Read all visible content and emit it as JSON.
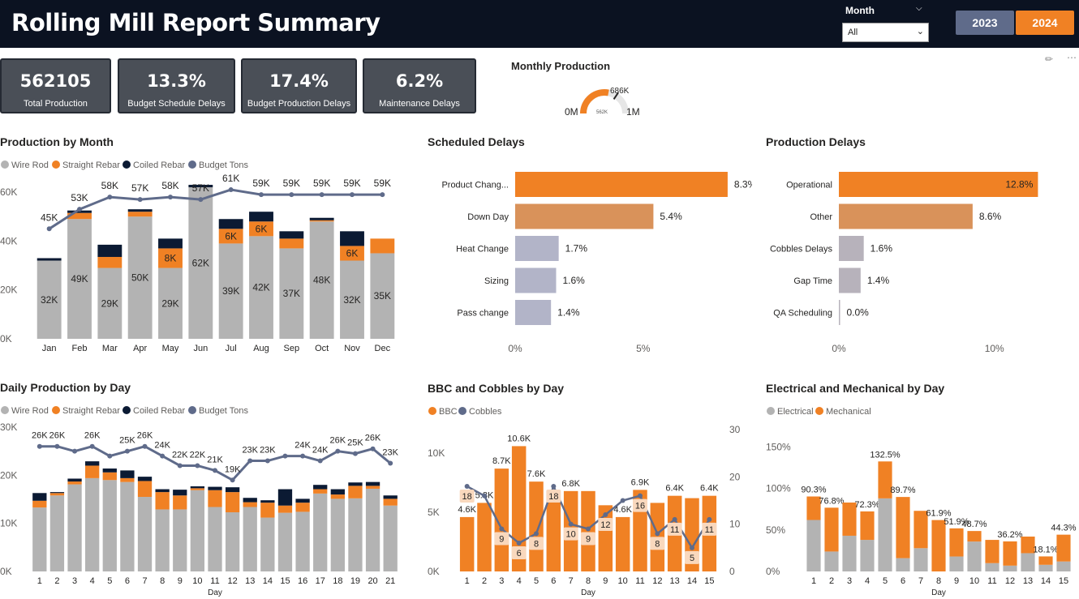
{
  "header": {
    "title": "Rolling Mill Report Summary",
    "month_slicer": {
      "label": "Month",
      "value": "All"
    },
    "year_buttons": [
      "2023",
      "2024"
    ],
    "selected_year": "2024"
  },
  "kpis": [
    {
      "value": "562105",
      "label": "Total Production"
    },
    {
      "value": "13.3%",
      "label": "Budget Schedule Delays"
    },
    {
      "value": "17.4%",
      "label": "Budget Production Delays"
    },
    {
      "value": "6.2%",
      "label": "Maintenance Delays"
    }
  ],
  "gauge": {
    "title": "Monthly Production",
    "min_label": "0M",
    "max_label": "1M",
    "target_label": "686K",
    "value_label": "562K",
    "value": 562105,
    "target": 686000,
    "max": 1000000
  },
  "colors": {
    "wire_rod": "#b3b3b3",
    "straight_rebar": "#f08124",
    "coiled_rebar": "#0b1a33",
    "budget": "#5f6b8a",
    "light_orange": "#d9925a",
    "light_grey": "#b2b4c8",
    "grey_bar": "#b7b2bb",
    "label_bg": "#f9d8bd"
  },
  "chart_data": [
    {
      "id": "production_by_month",
      "type": "bar",
      "title": "Production by Month",
      "legend": [
        "Wire Rod",
        "Straight Rebar",
        "Coiled Rebar",
        "Budget Tons"
      ],
      "categories": [
        "Jan",
        "Feb",
        "Mar",
        "Apr",
        "May",
        "Jun",
        "Jul",
        "Aug",
        "Sep",
        "Oct",
        "Nov",
        "Dec"
      ],
      "series": [
        {
          "name": "Wire Rod",
          "values": [
            32,
            49,
            29,
            50,
            29,
            62,
            39,
            42,
            37,
            48,
            32,
            35
          ],
          "labels": [
            "32K",
            "49K",
            "29K",
            "50K",
            "29K",
            "62K",
            "39K",
            "42K",
            "37K",
            "48K",
            "32K",
            "35K"
          ]
        },
        {
          "name": "Straight Rebar",
          "values": [
            0,
            2.5,
            4.5,
            2,
            8,
            0,
            6,
            6,
            4,
            0.5,
            6,
            6
          ],
          "labels": [
            "",
            "",
            "",
            "",
            "8K",
            "",
            "6K",
            "6K",
            "",
            "",
            "6K",
            ""
          ]
        },
        {
          "name": "Coiled Rebar",
          "values": [
            1,
            1,
            5,
            1,
            4,
            1,
            4,
            4,
            3,
            1,
            6,
            0
          ],
          "labels": [
            "",
            "",
            "",
            "",
            "",
            "",
            "",
            "",
            "",
            "",
            "",
            ""
          ]
        },
        {
          "name": "Budget Tons",
          "values": [
            45,
            53,
            58,
            57,
            58,
            57,
            61,
            59,
            59,
            59,
            59,
            59
          ],
          "labels": [
            "45K",
            "53K",
            "58K",
            "57K",
            "58K",
            "57K",
            "61K",
            "59K",
            "59K",
            "59K",
            "59K",
            "59K"
          ]
        }
      ],
      "ylim": [
        0,
        65
      ],
      "yticks": [
        "0K",
        "20K",
        "40K",
        "60K"
      ]
    },
    {
      "id": "scheduled_delays",
      "type": "bar",
      "title": "Scheduled Delays",
      "categories": [
        "Product Chang...",
        "Down Day",
        "Heat Change",
        "Sizing",
        "Pass change"
      ],
      "values": [
        8.3,
        5.4,
        1.7,
        1.6,
        1.4
      ],
      "labels": [
        "8.3%",
        "5.4%",
        "1.7%",
        "1.6%",
        "1.4%"
      ],
      "xticks": [
        "0%",
        "5%"
      ],
      "xlim": [
        0,
        9
      ]
    },
    {
      "id": "production_delays",
      "type": "bar",
      "title": "Production Delays",
      "categories": [
        "Operational",
        "Other",
        "Cobbles Delays",
        "Gap Time",
        "QA Scheduling"
      ],
      "values": [
        12.8,
        8.6,
        1.6,
        1.4,
        0.0
      ],
      "labels": [
        "12.8%",
        "8.6%",
        "1.6%",
        "1.4%",
        "0.0%"
      ],
      "xticks": [
        "0%",
        "10%"
      ],
      "xlim": [
        0,
        13.3
      ]
    },
    {
      "id": "daily_production",
      "type": "bar",
      "title": "Daily Production by Day",
      "legend": [
        "Wire Rod",
        "Straight Rebar",
        "Coiled Rebar",
        "Budget Tons"
      ],
      "xlabel": "Day",
      "categories": [
        "1",
        "2",
        "3",
        "4",
        "5",
        "6",
        "7",
        "8",
        "9",
        "10",
        "11",
        "12",
        "13",
        "14",
        "15",
        "16",
        "17",
        "18",
        "19",
        "20",
        "21"
      ],
      "series": [
        {
          "name": "Wire Rod",
          "values": [
            13.3,
            15.8,
            18.1,
            19.4,
            19,
            18.6,
            15.5,
            12.9,
            12.9,
            16.9,
            13.4,
            12.3,
            13.4,
            11.2,
            12.2,
            12.4,
            16.2,
            15.1,
            15.2,
            17.2,
            13.7
          ]
        },
        {
          "name": "Straight Rebar",
          "values": [
            1.4,
            0.5,
            0.6,
            2.6,
            1.6,
            0.8,
            3.3,
            3.6,
            2.9,
            0.4,
            3.5,
            4.2,
            1,
            3.1,
            1.5,
            1.9,
            0.9,
            0.9,
            2.6,
            0.6,
            1.4
          ]
        },
        {
          "name": "Coiled Rebar",
          "values": [
            1.6,
            0.2,
            0.6,
            0.9,
            0.8,
            1.6,
            0.9,
            0.6,
            1.2,
            0.4,
            0.7,
            1,
            0.9,
            0.5,
            3.4,
            0.8,
            0.9,
            1.1,
            0.7,
            0.8,
            0.7
          ]
        },
        {
          "name": "Budget Tons",
          "values": [
            26,
            26,
            25,
            26,
            24,
            25,
            26,
            24,
            22,
            22,
            21,
            19,
            23,
            23,
            24,
            24,
            23,
            25,
            24.5,
            25.5,
            22.5
          ],
          "labels": [
            "26K",
            "26K",
            "",
            "26K",
            "",
            "25K",
            "26K",
            "24K",
            "22K",
            "22K",
            "21K",
            "19K",
            "23K",
            "23K",
            "",
            "24K",
            "24K",
            "26K",
            "25K",
            "26K",
            "23K"
          ]
        }
      ],
      "ylim": [
        0,
        30
      ],
      "yticks": [
        "0K",
        "10K",
        "20K",
        "30K"
      ]
    },
    {
      "id": "bbc_cobbles",
      "type": "bar",
      "title": "BBC and Cobbles by Day",
      "legend": [
        "BBC",
        "Cobbles"
      ],
      "xlabel": "Day",
      "categories": [
        "1",
        "2",
        "3",
        "4",
        "5",
        "6",
        "7",
        "8",
        "9",
        "10",
        "11",
        "12",
        "13",
        "14",
        "15"
      ],
      "series": [
        {
          "name": "BBC",
          "values": [
            4.6,
            5.8,
            8.7,
            10.6,
            7.6,
            6.2,
            6.8,
            6.8,
            5.6,
            4.6,
            6.9,
            5.8,
            6.4,
            6.2,
            6.4
          ],
          "labels": [
            "4.6K",
            "5.8K",
            "8.7K",
            "10.6K",
            "7.6K",
            "",
            "6.8K",
            "",
            "",
            "4.6K",
            "6.9K",
            "",
            "6.4K",
            "",
            "6.4K"
          ]
        },
        {
          "name": "Cobbles",
          "values": [
            18,
            16,
            9,
            6,
            8,
            18,
            10,
            9,
            12,
            15,
            16,
            8,
            11,
            5,
            11
          ],
          "labels": [
            "18",
            "",
            "9",
            "6",
            "8",
            "18",
            "10",
            "9",
            "12",
            "",
            "16",
            "8",
            "11",
            "5",
            "11"
          ]
        }
      ],
      "ylim_left": [
        0,
        12
      ],
      "yticks_left": [
        "0K",
        "5K",
        "10K"
      ],
      "ylim_right": [
        0,
        30
      ],
      "yticks_right": [
        "0",
        "10",
        "20",
        "30"
      ]
    },
    {
      "id": "electrical_mechanical",
      "type": "bar",
      "title": "Electrical and Mechanical by Day",
      "legend": [
        "Electrical",
        "Mechanical"
      ],
      "xlabel": "Day",
      "categories": [
        "1",
        "2",
        "3",
        "4",
        "5",
        "6",
        "7",
        "8",
        "9",
        "10",
        "11",
        "12",
        "13",
        "14",
        "15"
      ],
      "series": [
        {
          "name": "Electrical",
          "values": [
            62,
            24,
            43,
            38,
            88,
            16,
            28,
            0,
            18,
            36,
            10,
            7,
            22,
            8,
            12
          ]
        },
        {
          "name": "Mechanical",
          "values": [
            28.3,
            52.8,
            40,
            34.3,
            44.5,
            73.7,
            45,
            61.9,
            33.9,
            12.7,
            28,
            29.2,
            20,
            10.1,
            32.3
          ]
        }
      ],
      "total_labels": [
        "90.3%",
        "76.8%",
        "",
        "72.3%",
        "132.5%",
        "89.7%",
        "",
        "61.9%",
        "51.9%",
        "48.7%",
        "",
        "36.2%",
        "",
        "18.1%",
        "44.3%"
      ],
      "ylim": [
        0,
        165
      ],
      "yticks": [
        "0%",
        "50%",
        "100%",
        "150%"
      ]
    }
  ]
}
